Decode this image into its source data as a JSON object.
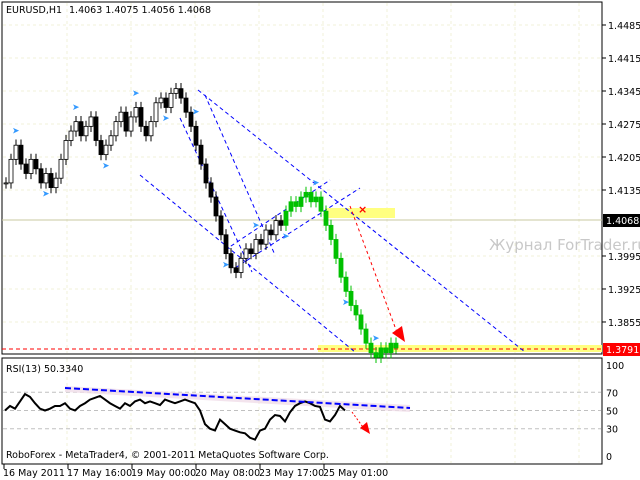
{
  "header": {
    "symbol": "EURUSD,H1",
    "ohlc": "1.4063 1.4075 1.4056 1.4068"
  },
  "watermark": "Журнал ForTrader.ru",
  "copyright": "RoboForex - MetaTrader4, © 2001-2011 MetaQuotes Software Corp.",
  "colors": {
    "bull": "#00c000",
    "bear": "#000000",
    "trend": "#0000ff",
    "target": "#ff0000",
    "zone": "#ffff80"
  },
  "chart_data": [
    {
      "type": "candlestick",
      "title": "EURUSD,H1",
      "ylim": [
        1.378,
        1.453
      ],
      "y_ticks": [
        "1.4485",
        "1.4415",
        "1.4345",
        "1.4275",
        "1.4205",
        "1.4135",
        "1.3995",
        "1.3925",
        "1.3855"
      ],
      "current_price": "1.4068",
      "level_price": "1.3791",
      "closes": [
        1.415,
        1.42,
        1.423,
        1.419,
        1.417,
        1.42,
        1.418,
        1.415,
        1.417,
        1.414,
        1.416,
        1.42,
        1.424,
        1.426,
        1.428,
        1.425,
        1.427,
        1.429,
        1.424,
        1.421,
        1.423,
        1.425,
        1.428,
        1.43,
        1.426,
        1.429,
        1.431,
        1.427,
        1.425,
        1.428,
        1.432,
        1.433,
        1.431,
        1.434,
        1.435,
        1.433,
        1.43,
        1.427,
        1.423,
        1.419,
        1.415,
        1.412,
        1.408,
        1.404,
        1.4,
        1.397,
        1.396,
        1.399,
        1.401,
        1.4,
        1.403,
        1.402,
        1.405,
        1.404,
        1.407,
        1.406,
        1.409,
        1.411,
        1.41,
        1.412,
        1.413,
        1.411,
        1.412,
        1.409,
        1.406,
        1.403,
        1.399,
        1.395,
        1.392,
        1.389,
        1.387,
        1.384,
        1.381,
        1.379,
        1.378,
        1.38,
        1.379,
        1.381,
        1.38
      ],
      "highlighted_from_index": 56
    },
    {
      "type": "line",
      "title": "RSI(13) 50.3340",
      "ylim": [
        0,
        100
      ],
      "y_ticks": [
        "100",
        "70",
        "50",
        "30",
        "0"
      ],
      "values": [
        50,
        55,
        52,
        60,
        68,
        65,
        58,
        52,
        50,
        52,
        55,
        55,
        58,
        52,
        50,
        55,
        58,
        62,
        64,
        66,
        62,
        58,
        55,
        52,
        58,
        55,
        60,
        62,
        58,
        60,
        58,
        56,
        62,
        60,
        58,
        60,
        62,
        60,
        58,
        50,
        35,
        30,
        28,
        40,
        35,
        30,
        28,
        26,
        25,
        20,
        18,
        28,
        30,
        40,
        45,
        44,
        38,
        48,
        55,
        58,
        60,
        58,
        55,
        54,
        40,
        38,
        45,
        55,
        50
      ]
    }
  ],
  "time_axis": [
    "16 May 2011",
    "17 May 16:00",
    "19 May 00:00",
    "20 May 08:00",
    "23 May 17:00",
    "25 May 01:00"
  ]
}
